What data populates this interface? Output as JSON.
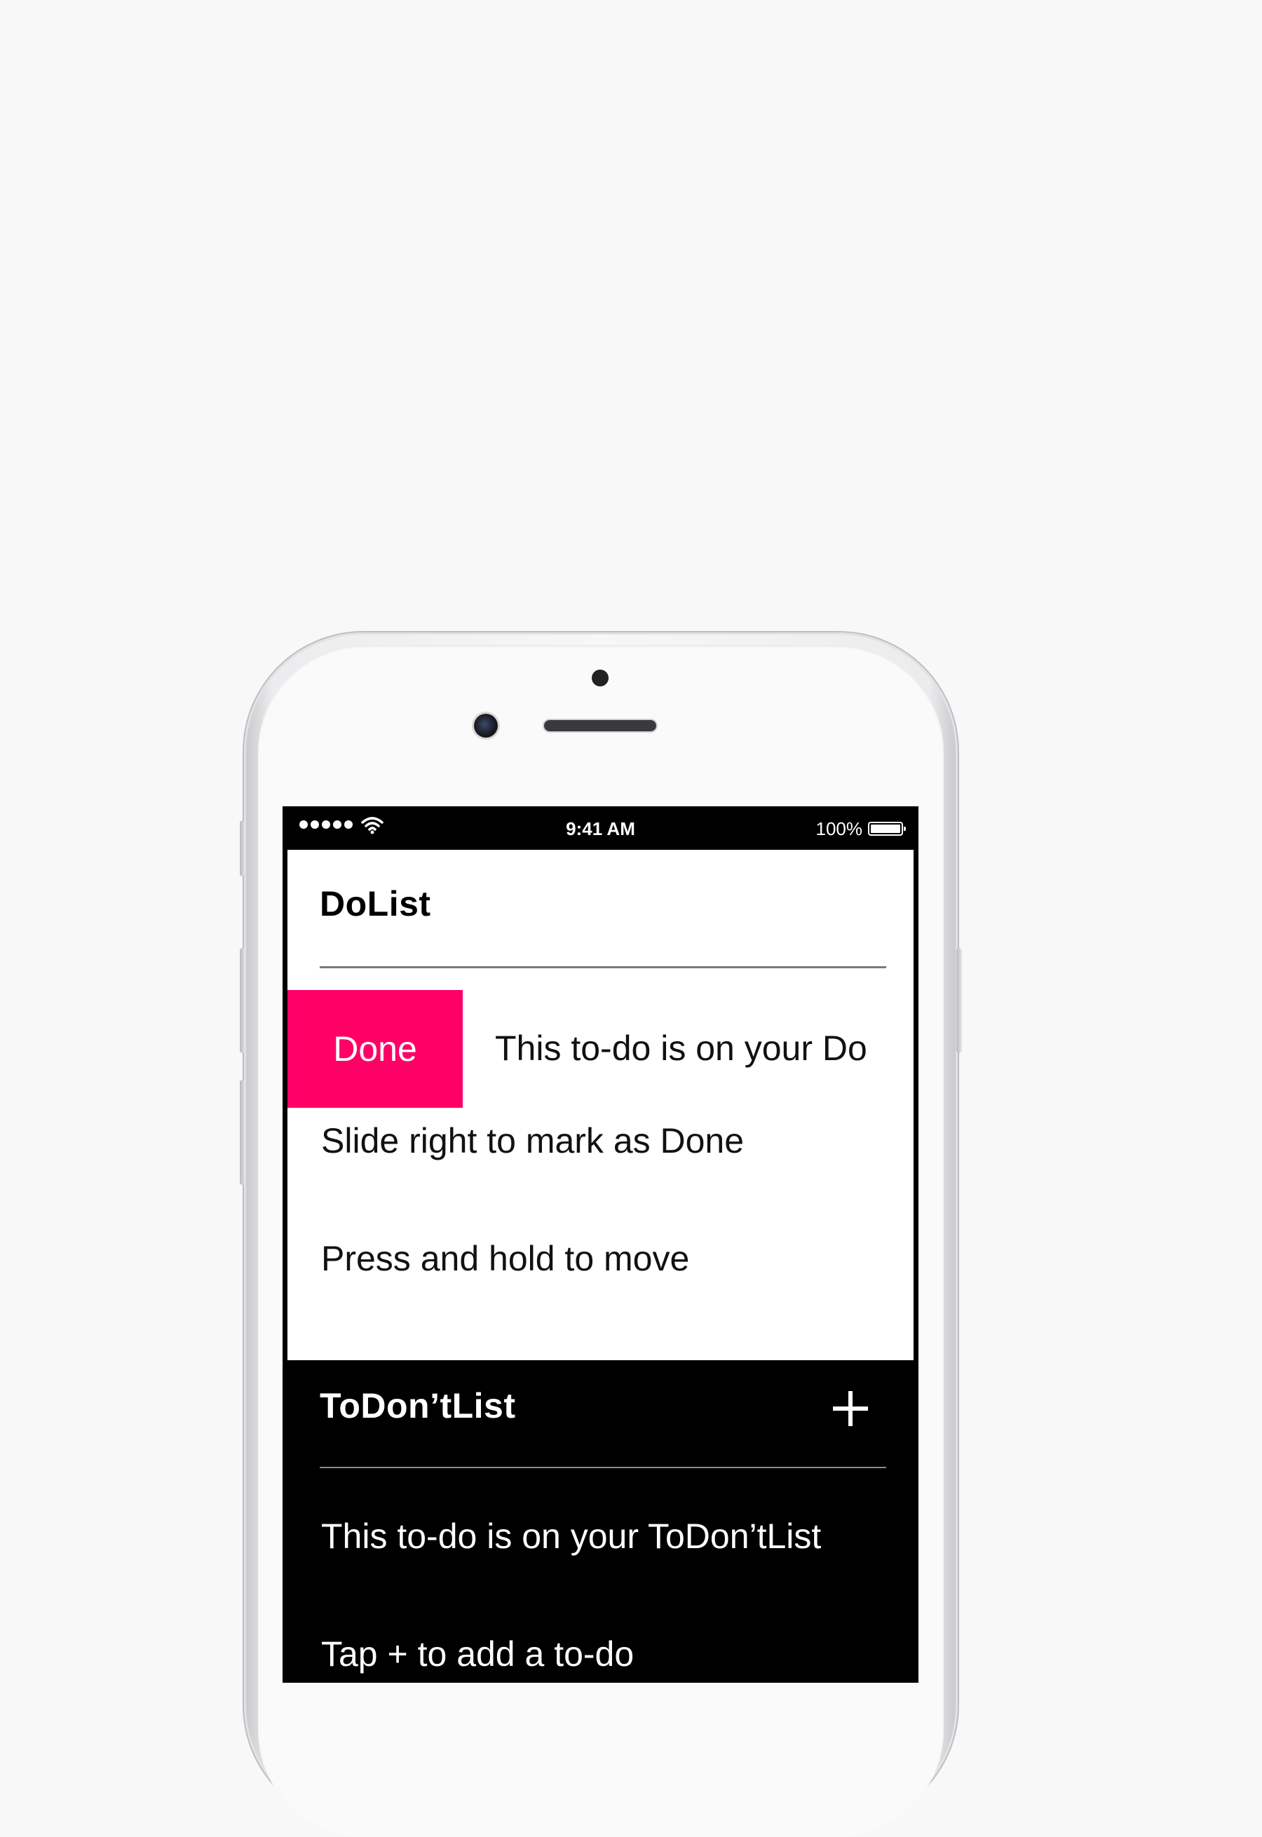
{
  "status_bar": {
    "time": "9:41 AM",
    "battery_percent": "100%",
    "battery_level": 1.0,
    "signal_bars": 5
  },
  "do_list": {
    "title": "DoList",
    "swipe_action_label": "Done",
    "swipe_action_color": "#ff0066",
    "items": [
      "This to-do is on your Do",
      "Slide right to mark as Done",
      "Press and hold to move"
    ]
  },
  "dont_list": {
    "title": "ToDon’tList",
    "add_icon": "plus-icon",
    "items": [
      "This to-do is on your ToDon’tList",
      "Tap + to add a to-do"
    ]
  },
  "colors": {
    "accent": "#ff0066",
    "background": "#f8f8f8",
    "dolist_bg": "#ffffff",
    "dontlist_bg": "#000000"
  }
}
